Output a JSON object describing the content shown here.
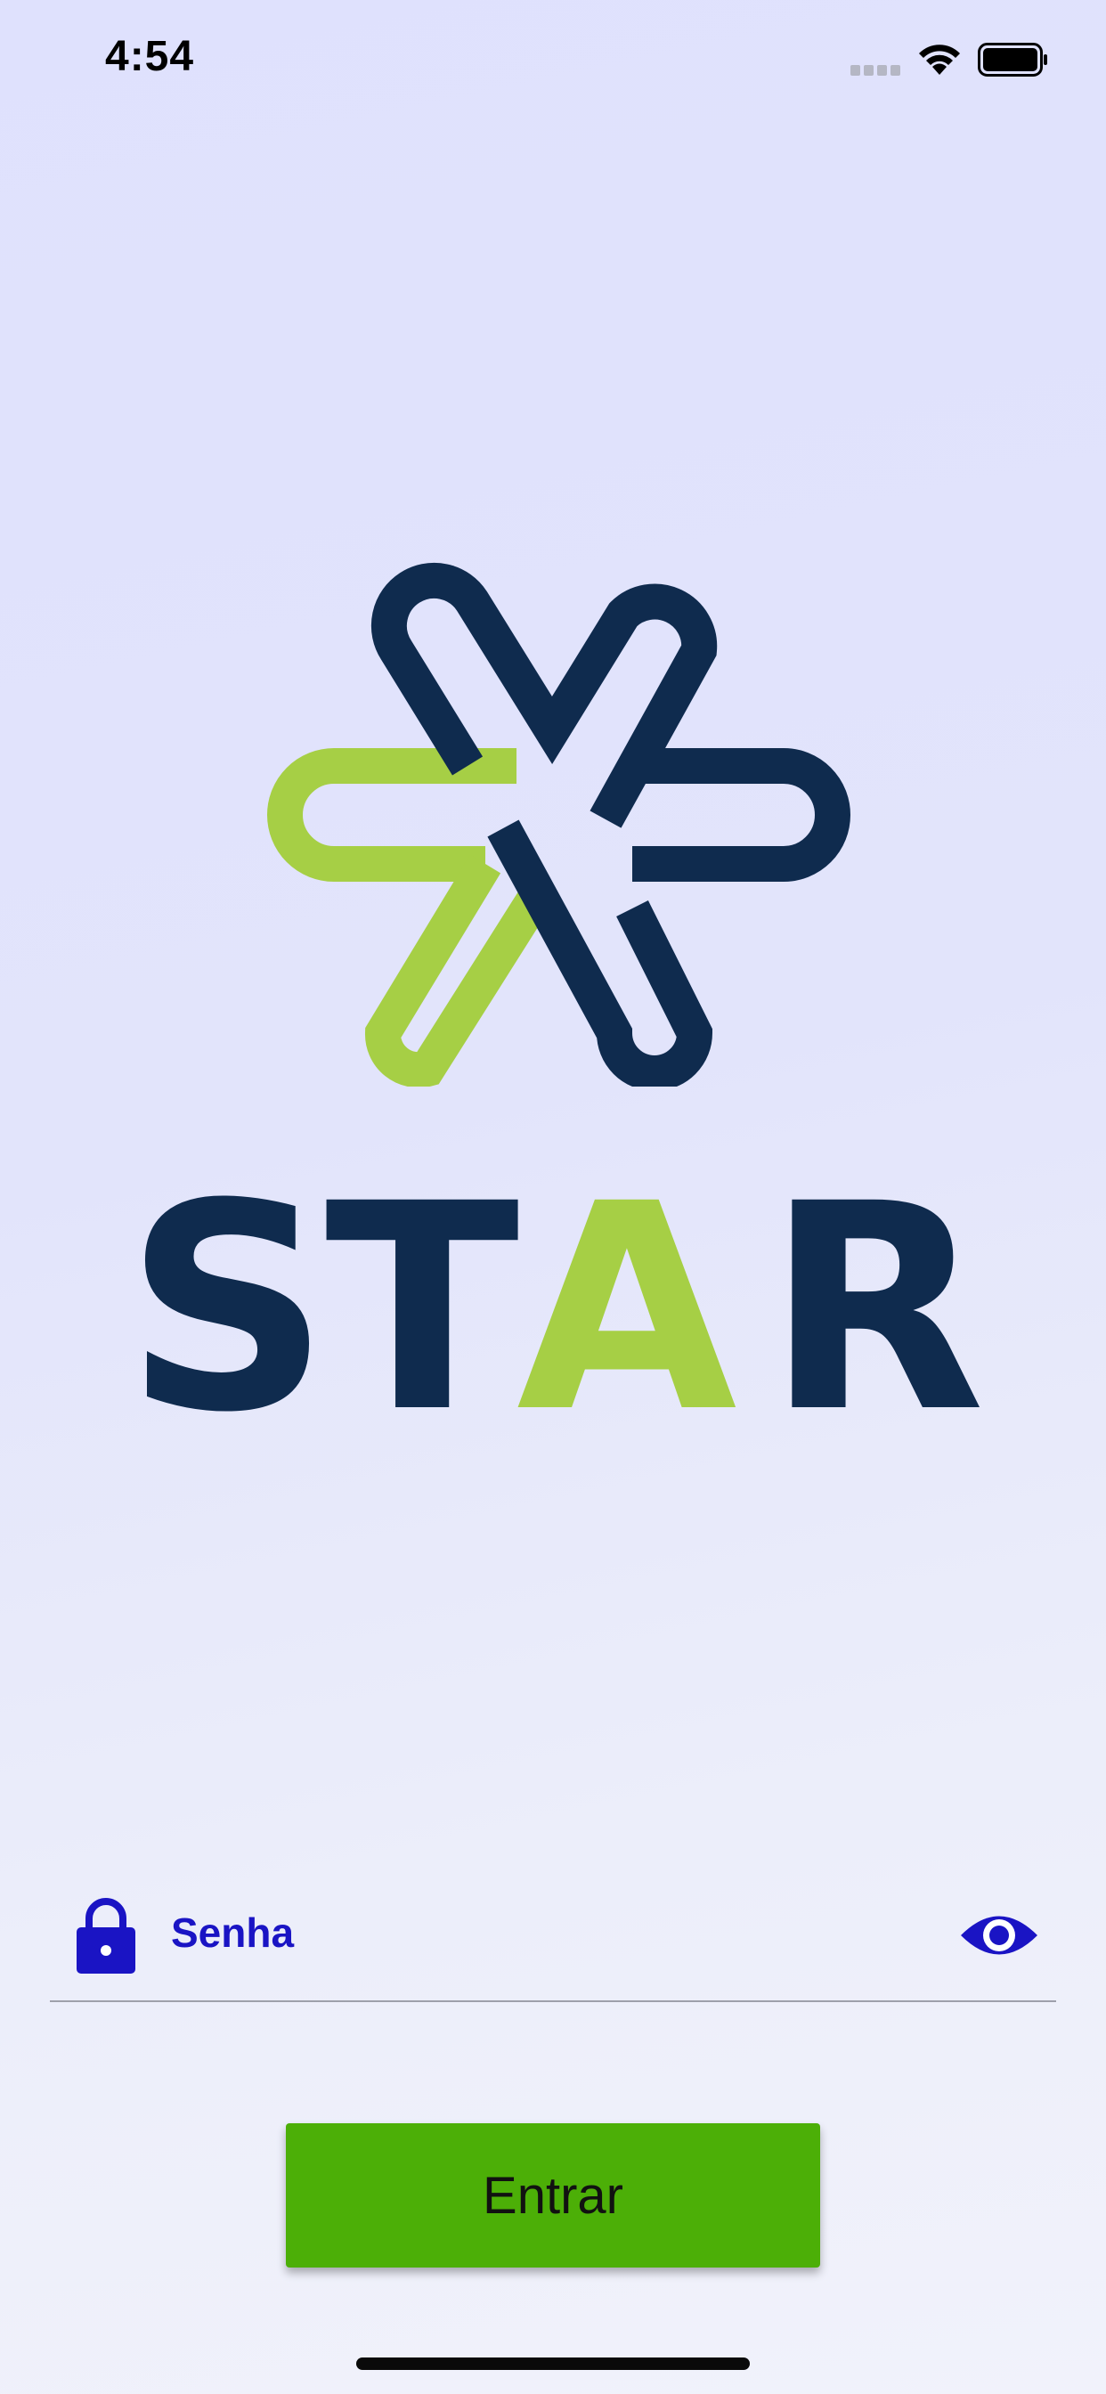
{
  "status_bar": {
    "time": "4:54",
    "icons": [
      "signal-icon",
      "wifi-icon",
      "battery-icon"
    ]
  },
  "logo": {
    "wordmark": "STAR",
    "colors": {
      "navy": "#0f2b4e",
      "green": "#a6cf45"
    }
  },
  "login": {
    "password_placeholder": "Senha",
    "password_value": "",
    "lock_icon": "lock-icon",
    "show_password_icon": "eye-icon",
    "submit_label": "Entrar"
  },
  "colors": {
    "accent_blue": "#1a14c4",
    "button_green": "#4caf07"
  }
}
